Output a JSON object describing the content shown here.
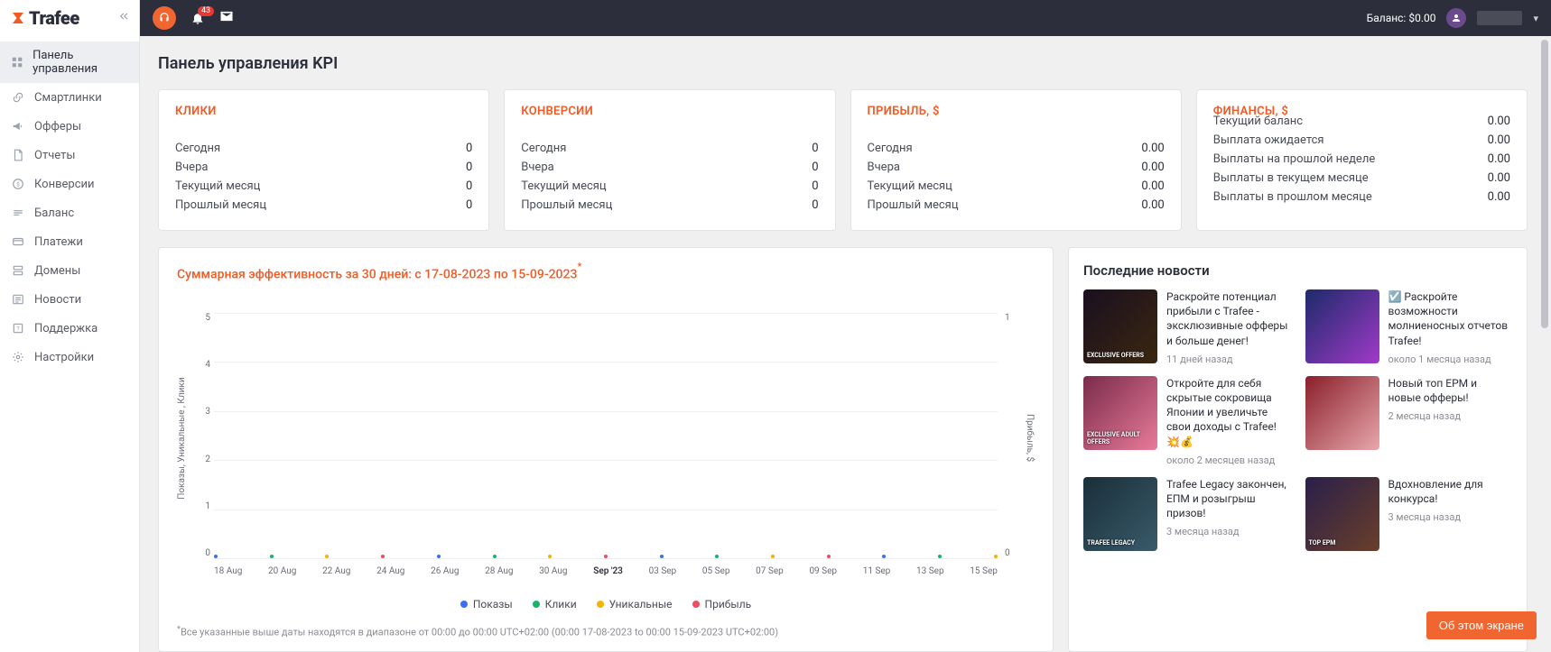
{
  "brand": "Trafee",
  "notifications_count": "43",
  "balance_label": "Баланс:",
  "balance_value": "$0.00",
  "sidebar": {
    "items": [
      {
        "label": "Панель управления",
        "icon": "dashboard-icon",
        "active": true
      },
      {
        "label": "Смартлинки",
        "icon": "link-icon"
      },
      {
        "label": "Офферы",
        "icon": "megaphone-icon"
      },
      {
        "label": "Отчеты",
        "icon": "file-icon"
      },
      {
        "label": "Конверсии",
        "icon": "dollar-icon"
      },
      {
        "label": "Баланс",
        "icon": "balance-icon"
      },
      {
        "label": "Платежи",
        "icon": "card-icon"
      },
      {
        "label": "Домены",
        "icon": "server-icon"
      },
      {
        "label": "Новости",
        "icon": "news-icon"
      },
      {
        "label": "Поддержка",
        "icon": "help-icon"
      },
      {
        "label": "Настройки",
        "icon": "gear-icon"
      }
    ]
  },
  "page_title": "Панель управления KPI",
  "kpi": [
    {
      "title": "КЛИКИ",
      "rows": [
        [
          "Сегодня",
          "0"
        ],
        [
          "Вчера",
          "0"
        ],
        [
          "Текущий месяц",
          "0"
        ],
        [
          "Прошлый месяц",
          "0"
        ]
      ]
    },
    {
      "title": "КОНВЕРСИИ",
      "rows": [
        [
          "Сегодня",
          "0"
        ],
        [
          "Вчера",
          "0"
        ],
        [
          "Текущий месяц",
          "0"
        ],
        [
          "Прошлый месяц",
          "0"
        ]
      ]
    },
    {
      "title": "ПРИБЫЛЬ, $",
      "rows": [
        [
          "Сегодня",
          "0.00"
        ],
        [
          "Вчера",
          "0.00"
        ],
        [
          "Текущий месяц",
          "0.00"
        ],
        [
          "Прошлый месяц",
          "0.00"
        ]
      ]
    },
    {
      "title": "ФИНАНСЫ, $",
      "rows": [
        [
          "Текущий баланс",
          "0.00"
        ],
        [
          "Выплата ожидается",
          "0.00"
        ],
        [
          "Выплаты на прошлой неделе",
          "0.00"
        ],
        [
          "Выплаты в текущем месяце",
          "0.00"
        ],
        [
          "Выплаты в прошлом месяце",
          "0.00"
        ]
      ],
      "finance": true
    }
  ],
  "performance": {
    "title": "Суммарная эффективность за 30 дней: с 17-08-2023 по 15-09-2023",
    "y_left_label": "Показы, Уникальные , Клики",
    "y_right_label": "Прибыль, $",
    "footnote": "Все указанные выше даты находятся в диапазоне от 00:00 до 00:00 UTC+02:00 (00:00 17-08-2023 to 00:00 15-09-2023 UTC+02:00)",
    "legend": [
      {
        "label": "Показы",
        "color": "#3a6ff0"
      },
      {
        "label": "Клики",
        "color": "#19b26b"
      },
      {
        "label": "Уникальные",
        "color": "#f3b300"
      },
      {
        "label": "Прибыль",
        "color": "#f04d5e"
      }
    ]
  },
  "chart_data": {
    "type": "line",
    "categories": [
      "18 Aug",
      "20 Aug",
      "22 Aug",
      "24 Aug",
      "26 Aug",
      "28 Aug",
      "30 Aug",
      "Sep '23",
      "03 Sep",
      "05 Sep",
      "07 Sep",
      "09 Sep",
      "11 Sep",
      "13 Sep",
      "15 Sep"
    ],
    "y_left_ticks": [
      5,
      4,
      3,
      2,
      1,
      0
    ],
    "y_right_ticks": [
      1,
      0
    ],
    "ylim_left": [
      0,
      5
    ],
    "ylim_right": [
      0,
      1
    ],
    "series": [
      {
        "name": "Показы",
        "color": "#3a6ff0",
        "values": [
          0,
          0,
          0,
          0,
          0,
          0,
          0,
          0,
          0,
          0,
          0,
          0,
          0,
          0,
          0
        ]
      },
      {
        "name": "Клики",
        "color": "#19b26b",
        "values": [
          0,
          0,
          0,
          0,
          0,
          0,
          0,
          0,
          0,
          0,
          0,
          0,
          0,
          0,
          0
        ]
      },
      {
        "name": "Уникальные",
        "color": "#f3b300",
        "values": [
          0,
          0,
          0,
          0,
          0,
          0,
          0,
          0,
          0,
          0,
          0,
          0,
          0,
          0,
          0
        ]
      },
      {
        "name": "Прибыль",
        "color": "#f04d5e",
        "values": [
          0,
          0,
          0,
          0,
          0,
          0,
          0,
          0,
          0,
          0,
          0,
          0,
          0,
          0,
          0
        ]
      }
    ]
  },
  "news": {
    "title": "Последние новости",
    "items": [
      {
        "headline": "Раскройте потенциал прибыли с Trafee - эксклюзивные офферы и больше денег!",
        "date": "11 дней назад",
        "tag": "EXCLUSIVE OFFERS",
        "bg": "linear-gradient(135deg,#1a0f1f,#3a2710)"
      },
      {
        "headline": "☑️ Раскройте возможности молниеносных отчетов Trafee!",
        "date": "около 1 месяца назад",
        "tag": "",
        "bg": "linear-gradient(135deg,#1d2a6b,#a03ac8)"
      },
      {
        "headline": "Откройте для себя скрытые сокровища Японии и увеличьте свои доходы с Trafee! 💥💰",
        "date": "около 2 месяцев назад",
        "tag": "EXCLUSIVE ADULT OFFERS",
        "bg": "linear-gradient(135deg,#7a2b4a,#e87b9a)"
      },
      {
        "headline": "Новый топ EPM и новые офферы!",
        "date": "2 месяца назад",
        "tag": "",
        "bg": "linear-gradient(135deg,#8a1f2a,#e8a7ad)"
      },
      {
        "headline": "Trafee Legacy закончен, ЕПМ и розыгрыш призов!",
        "date": "3 месяца назад",
        "tag": "TRAFEE LEGACY",
        "bg": "linear-gradient(135deg,#1a2f3a,#3a5a6a)"
      },
      {
        "headline": "Вдохновление для конкурса!",
        "date": "3 месяца назад",
        "tag": "TOP EPM",
        "bg": "linear-gradient(135deg,#2a1f4a,#6a3f2a)"
      }
    ]
  },
  "about_button": "Об этом экране"
}
